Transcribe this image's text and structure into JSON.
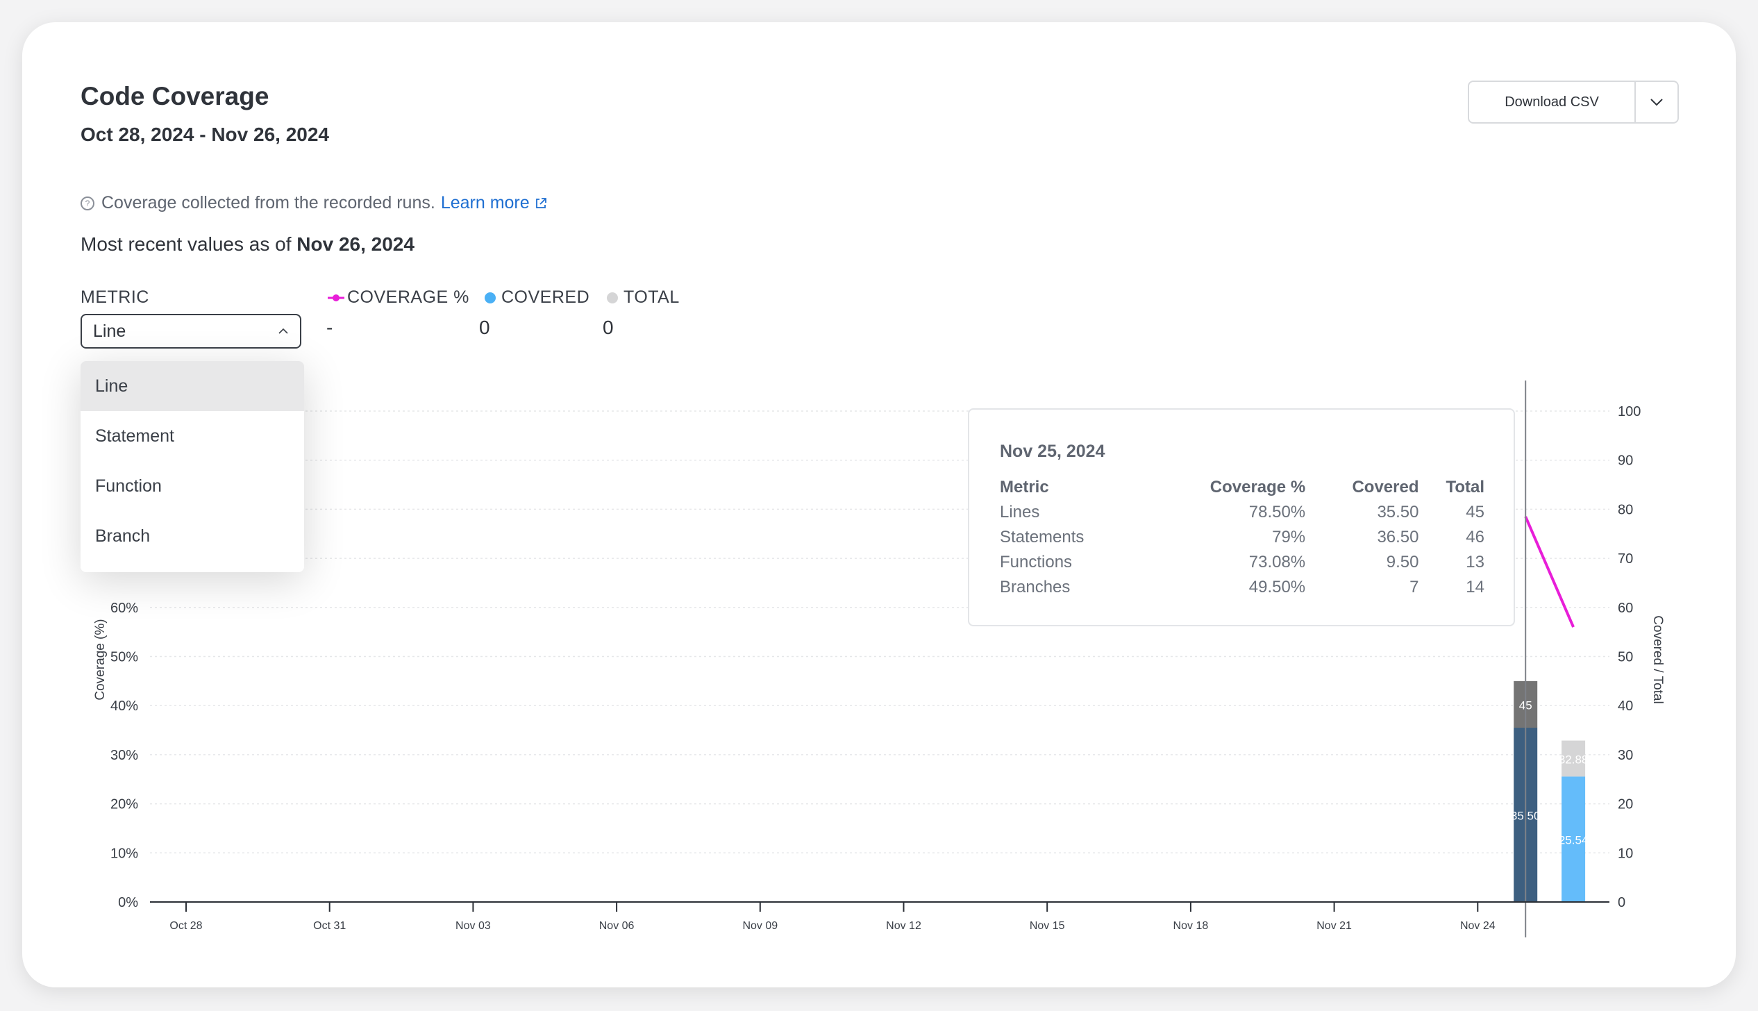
{
  "header": {
    "title": "Code Coverage",
    "date_range": "Oct 28, 2024 - Nov 26, 2024",
    "download_label": "Download CSV"
  },
  "info": {
    "text": "Coverage collected from the recorded runs.",
    "link": "Learn more"
  },
  "recent": {
    "prefix": "Most recent values as of",
    "date": "Nov 26, 2024"
  },
  "metric": {
    "label": "METRIC",
    "selected": "Line",
    "options": [
      "Line",
      "Statement",
      "Function",
      "Branch"
    ]
  },
  "legend": [
    {
      "label": "COVERAGE %",
      "value": "-",
      "color": "#e81ed8"
    },
    {
      "label": "COVERED",
      "value": "0",
      "color": "#4ab0f5"
    },
    {
      "label": "TOTAL",
      "value": "0",
      "color": "#d5d5d6"
    }
  ],
  "tooltip": {
    "date": "Nov 25, 2024",
    "headers": [
      "Metric",
      "Coverage %",
      "Covered",
      "Total"
    ],
    "rows": [
      [
        "Lines",
        "78.50%",
        "35.50",
        "45"
      ],
      [
        "Statements",
        "79%",
        "36.50",
        "46"
      ],
      [
        "Functions",
        "73.08%",
        "9.50",
        "13"
      ],
      [
        "Branches",
        "49.50%",
        "7",
        "14"
      ]
    ]
  },
  "chart_data": {
    "type": "bar",
    "x_ticks": [
      "Oct 28",
      "Oct 31",
      "Nov 03",
      "Nov 06",
      "Nov 09",
      "Nov 12",
      "Nov 15",
      "Nov 18",
      "Nov 21",
      "Nov 24"
    ],
    "ylabel_left": "Coverage (%)",
    "ylabel_right": "Covered / Total",
    "left_ticks": [
      "0%",
      "10%",
      "20%",
      "30%",
      "40%",
      "50%",
      "60%"
    ],
    "right_ticks": [
      "0",
      "10",
      "20",
      "30",
      "40",
      "50",
      "60",
      "70",
      "80",
      "90",
      "100"
    ],
    "ylim_left": [
      0,
      100
    ],
    "ylim_right": [
      0,
      100
    ],
    "x_range": [
      "2024-10-28",
      "2024-11-26"
    ],
    "series": [
      {
        "name": "COVERAGE %",
        "kind": "line",
        "color": "#e81ed8",
        "points": [
          {
            "date": "2024-11-25",
            "value": 78.5
          },
          {
            "date": "2024-11-26",
            "value": 56
          }
        ]
      },
      {
        "name": "COVERED",
        "kind": "bar",
        "colors": [
          "#3d5f80",
          "#64bcfa"
        ],
        "points": [
          {
            "date": "2024-11-25",
            "value": 35.5,
            "label": "35.50"
          },
          {
            "date": "2024-11-26",
            "value": 25.54,
            "label": "25.54"
          }
        ]
      },
      {
        "name": "TOTAL",
        "kind": "bar",
        "colors": [
          "#747474",
          "#d5d5d6"
        ],
        "points": [
          {
            "date": "2024-11-25",
            "value": 45,
            "label": "45"
          },
          {
            "date": "2024-11-26",
            "value": 32.88,
            "label": "32.88"
          }
        ]
      }
    ],
    "hover_date": "2024-11-25",
    "grid": true
  }
}
